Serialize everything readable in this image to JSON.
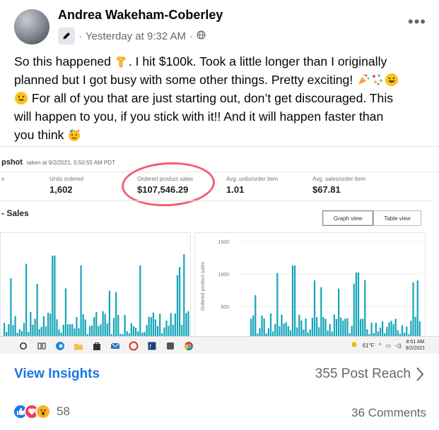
{
  "post": {
    "author": "Andrea Wakeham-Coberley",
    "time": "Yesterday at 9:32 AM",
    "separator": "·",
    "author_badge_icon": "pen-icon",
    "audience_icon": "globe-icon",
    "more_icon": "more-horizontal-icon",
    "more_label": "•••",
    "text": {
      "line1_a": "So this happened",
      "line1_b": ". I hit $100k. Took a little longer than I originally",
      "line2": "planned but I got busy with some other things. Pretty exciting!",
      "line3": "For all of you that are just starting out, don’t get discouraged. This",
      "line4": "will happen to you, if you stick with it!! And it will happen faster than",
      "line5": "you think"
    }
  },
  "screenshot": {
    "snapshot_title": "pshot",
    "taken": "taken at 9/2/2021, 5:50:55 AM PDT",
    "metrics": [
      {
        "label": "s",
        "value": ""
      },
      {
        "label": "Units ordered",
        "value": "1,602"
      },
      {
        "label": "Ordered product sales",
        "value": "$107,546.29"
      },
      {
        "label": "Avg. units/order item",
        "value": "1.01"
      },
      {
        "label": "Avg. sales/order item",
        "value": "$67.81"
      }
    ],
    "sales_title": "Sales",
    "graph_view_label": "Graph view",
    "table_view_label": "Table view",
    "y_axis_title": "Ordered product sales",
    "y_ticks": [
      "1500",
      "1000",
      "500"
    ],
    "taskbar": {
      "icons": [
        "search-icon",
        "task-view-icon",
        "edge-icon",
        "file-explorer-icon",
        "store-icon",
        "mail-icon",
        "app-icon",
        "app-icon",
        "app-icon",
        "chrome-icon"
      ],
      "weather": "61°F",
      "time": "8:51 AM",
      "date": "9/2/2021"
    }
  },
  "footer": {
    "insights_label": "View Insights",
    "reach_label": "355 Post Reach",
    "reactions_count": "58",
    "comments_label": "36 Comments"
  },
  "colors": {
    "link_blue": "#1b74e4",
    "chart_teal": "#15a5b8",
    "highlight_pink": "#f04d6d"
  }
}
